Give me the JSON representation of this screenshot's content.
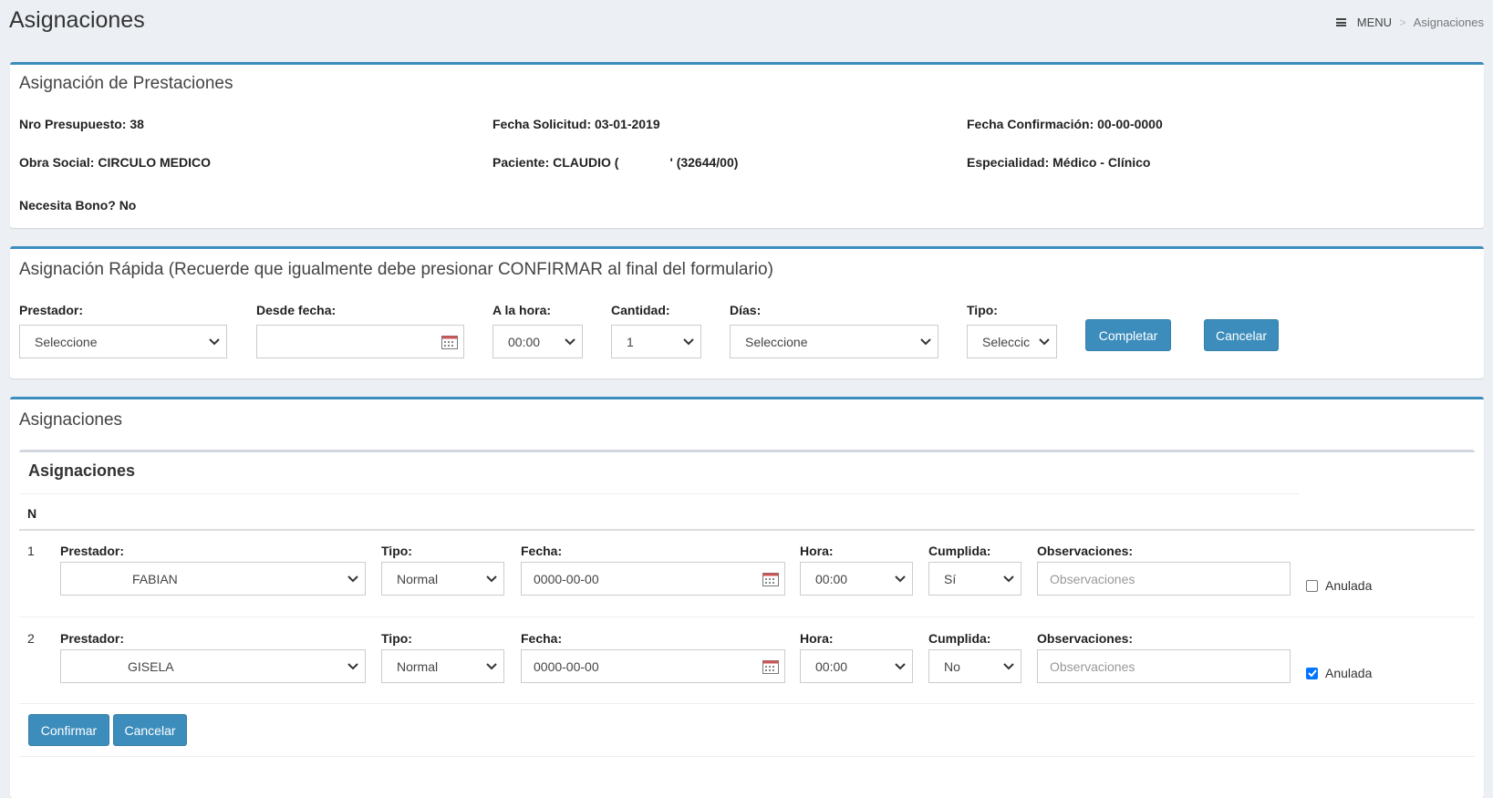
{
  "page": {
    "title": "Asignaciones"
  },
  "breadcrumb": {
    "menu": "MENU",
    "current": "Asignaciones",
    "separator": ">"
  },
  "prestaciones": {
    "title": "Asignación de Prestaciones",
    "nro_presupuesto": "Nro Presupuesto: 38",
    "fecha_solicitud": "Fecha Solicitud: 03-01-2019",
    "fecha_confirmacion": "Fecha Confirmación: 00-00-0000",
    "obra_social": "Obra Social: CIRCULO MEDICO",
    "paciente_label": "Paciente: CLAUDIO (",
    "paciente_suffix": "' (32644/00)",
    "especialidad": "Especialidad: Médico - Clínico",
    "bono": "Necesita Bono? No"
  },
  "rapida": {
    "title": "Asignación Rápida (Recuerde que igualmente debe presionar CONFIRMAR al final del formulario)",
    "prestador_label": "Prestador:",
    "prestador_value": "Seleccione",
    "desde_label": "Desde fecha:",
    "desde_value": "",
    "hora_label": "A la hora:",
    "hora_value": "00:00",
    "cantidad_label": "Cantidad:",
    "cantidad_value": "1",
    "dias_label": "Días:",
    "dias_value": "Seleccione",
    "tipo_label": "Tipo:",
    "tipo_value": "Seleccic",
    "completar": "Completar",
    "cancelar": "Cancelar"
  },
  "asignaciones": {
    "outer_title": "Asignaciones",
    "inner_title": "Asignaciones",
    "n_header": "N",
    "labels": {
      "prestador": "Prestador:",
      "tipo": "Tipo:",
      "fecha": "Fecha:",
      "hora": "Hora:",
      "cumplida": "Cumplida:",
      "observaciones": "Observaciones:",
      "anulada": "Anulada",
      "obs_placeholder": "Observaciones"
    },
    "rows": [
      {
        "n": "1",
        "prestador": "FABIAN",
        "tipo": "Normal",
        "fecha": "0000-00-00",
        "hora": "00:00",
        "cumplida": "Sí",
        "observaciones": "",
        "anulada": false
      },
      {
        "n": "2",
        "prestador": "GISELA",
        "tipo": "Normal",
        "fecha": "0000-00-00",
        "hora": "00:00",
        "cumplida": "No",
        "observaciones": "",
        "anulada": true
      }
    ],
    "confirmar": "Confirmar",
    "cancelar": "Cancelar"
  },
  "colors": {
    "accent": "#3c8dbc",
    "background": "#ecf0f5"
  }
}
